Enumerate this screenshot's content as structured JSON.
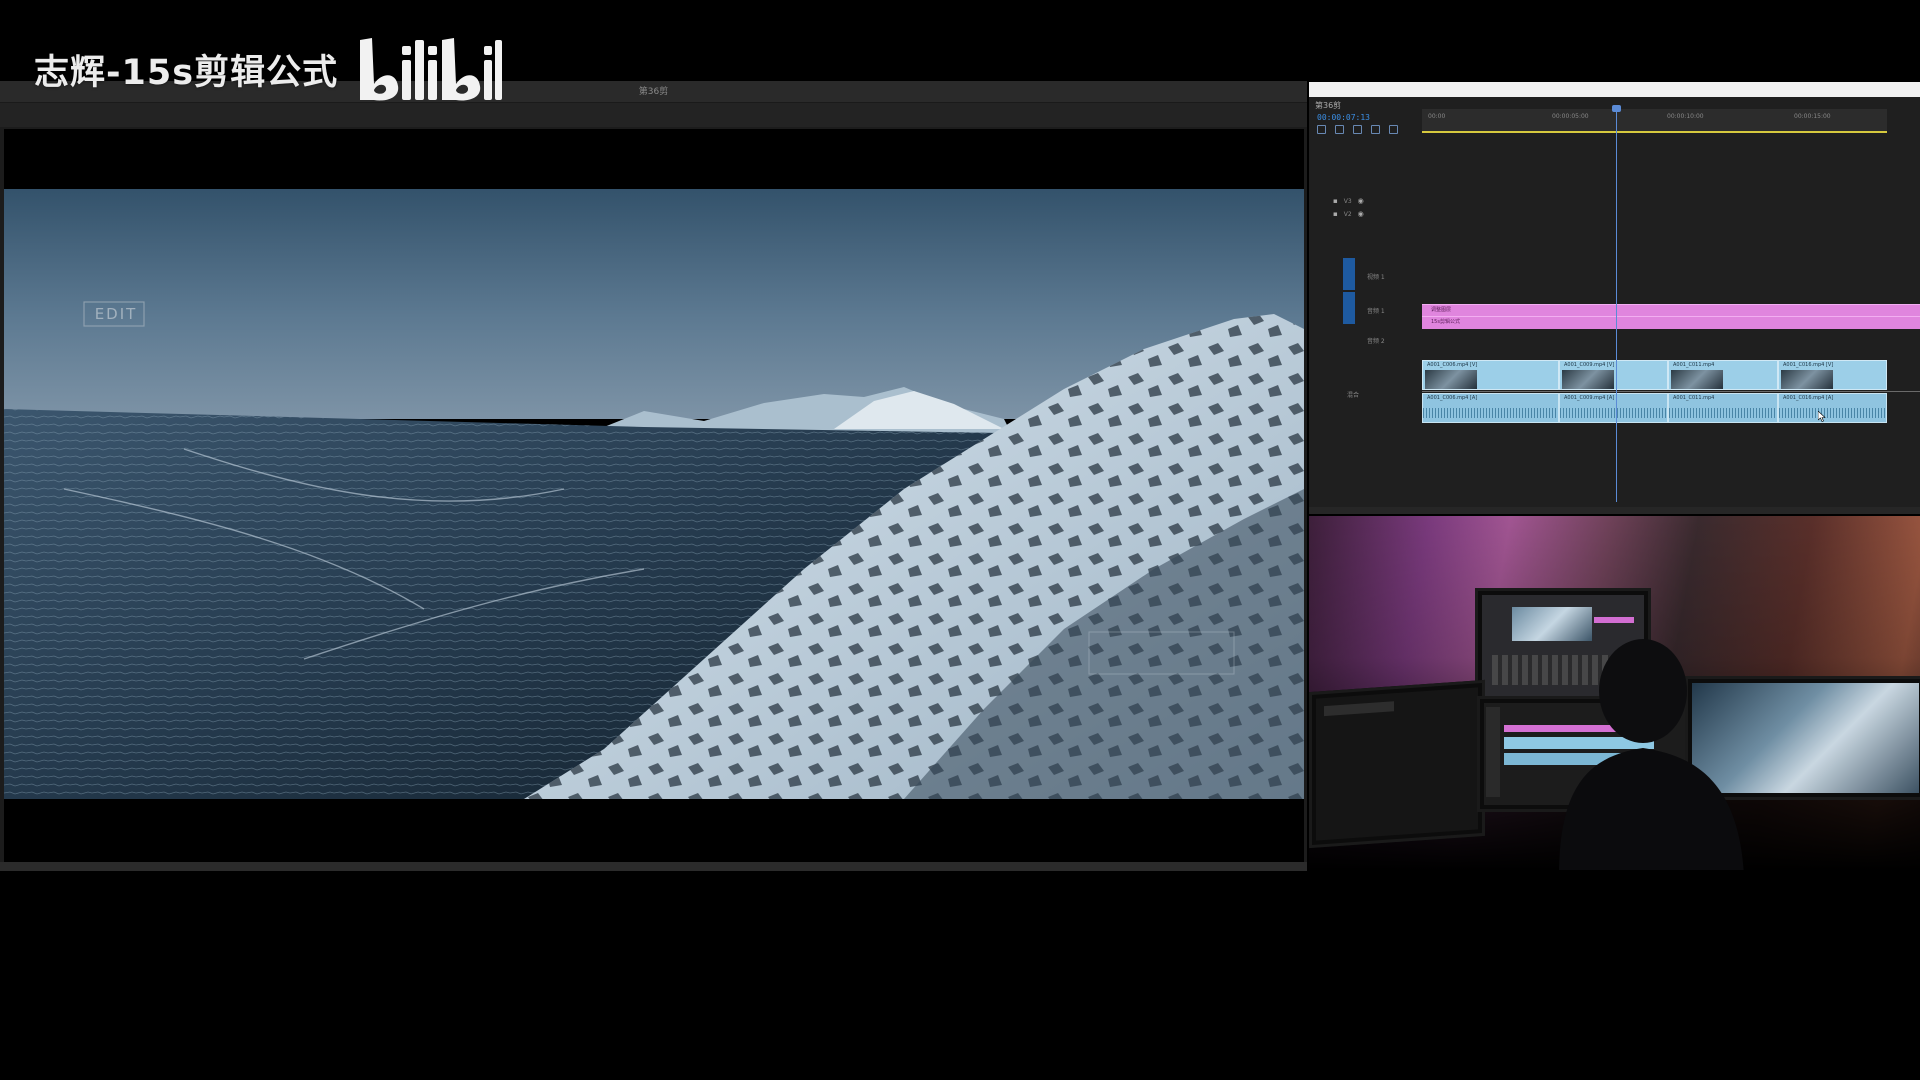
{
  "watermark": {
    "text": "志辉-15s剪辑公式",
    "logo": "bilibili"
  },
  "program_monitor": {
    "title": "第36剪",
    "overlay_text": "EDIT"
  },
  "timeline": {
    "sequence_tab": "第36剪",
    "timecode": "00:00:07:13",
    "ruler_labels": [
      "00:00",
      "00:00:05:00",
      "00:00:10:00",
      "00:00:15:00"
    ],
    "tracks": {
      "v3": "V3",
      "v2": "V2",
      "v1": "视频 1",
      "a1": "音频 1",
      "a2": "音频 2",
      "master": "混合"
    },
    "pink_clips": [
      "调整图层",
      "15s剪辑公式"
    ],
    "video_clips": [
      "A001_C006.mp4 [V]",
      "A001_C009.mp4 [V]",
      "A001_C011.mp4",
      "A001_C016.mp4 [V]"
    ],
    "audio_clips": [
      "A001_C006.mp4 [A]",
      "A001_C009.mp4 [A]",
      "A001_C011.mp4",
      "A001_C016.mp4 [A]"
    ]
  },
  "colors": {
    "pink_clip": "#e085de",
    "video_clip": "#9ccfe8",
    "timecode": "#3b8fe6",
    "work_area": "#d6c93e"
  }
}
